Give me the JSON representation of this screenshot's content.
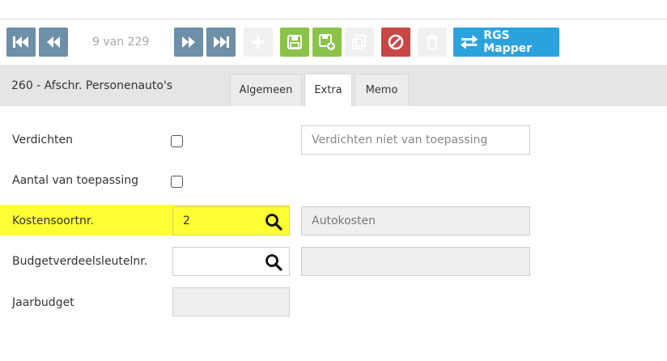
{
  "toolbar": {
    "counter": "9 van 229",
    "rgs_label": "RGS Mapper"
  },
  "record": {
    "title": "260 - Afschr. Personenauto's"
  },
  "tabs": [
    {
      "label": "Algemeen"
    },
    {
      "label": "Extra"
    },
    {
      "label": "Memo"
    }
  ],
  "form": {
    "verdichten": {
      "label": "Verdichten",
      "placeholder": "Verdichten niet van toepassing"
    },
    "aantal": {
      "label": "Aantal van toepassing"
    },
    "kostensoort": {
      "label": "Kostensoortnr.",
      "value": "2",
      "description": "Autokosten"
    },
    "budget": {
      "label": "Budgetverdeelsleutelnr.",
      "value": "",
      "description": ""
    },
    "jaarbudget": {
      "label": "Jaarbudget",
      "value": ""
    }
  },
  "colors": {
    "steel": "#6d8fa8",
    "green": "#8bc34a",
    "red": "#c94646",
    "blue": "#2aa3dd",
    "highlight": "#ffff33"
  }
}
